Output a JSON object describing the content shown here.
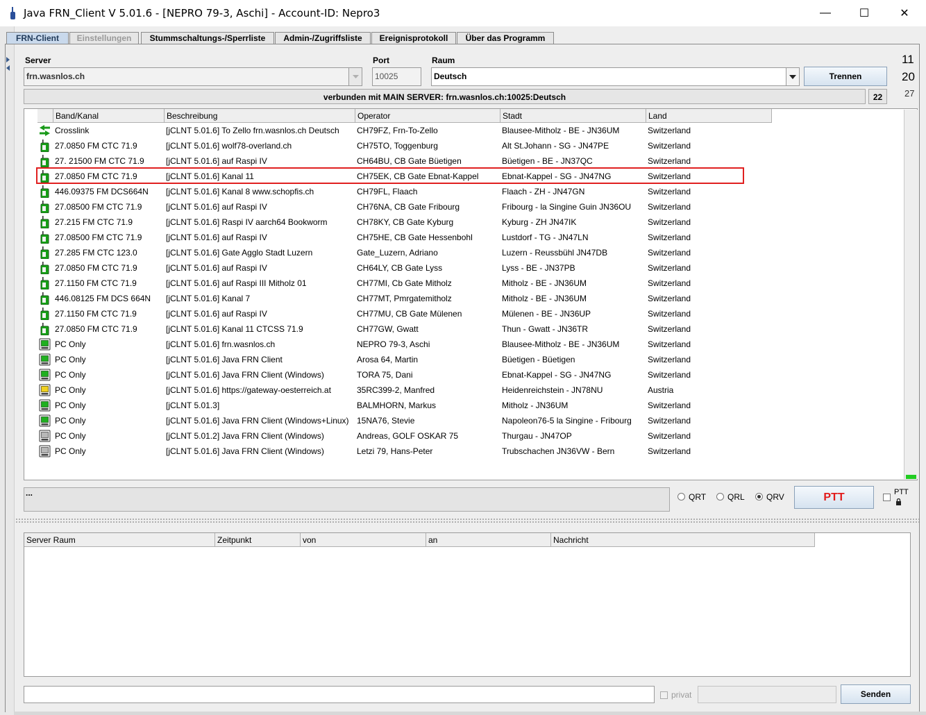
{
  "window": {
    "title": "Java FRN_Client V 5.01.6 - [NEPRO 79-3, Aschi] - Account-ID: Nepro3",
    "minimize": "—",
    "maximize": "☐",
    "close": "✕"
  },
  "tabs": [
    {
      "label": "FRN-Client"
    },
    {
      "label": "Einstellungen"
    },
    {
      "label": "Stummschaltungs-/Sperrliste"
    },
    {
      "label": "Admin-/Zugriffsliste"
    },
    {
      "label": "Ereignisprotokoll"
    },
    {
      "label": "Über das Programm"
    }
  ],
  "connection": {
    "server_label": "Server",
    "server_value": "frn.wasnlos.ch",
    "port_label": "Port",
    "port_value": "10025",
    "room_label": "Raum",
    "room_value": "Deutsch",
    "disconnect_label": "Trennen",
    "status_text": "verbunden mit  MAIN SERVER: frn.wasnlos.ch:10025:Deutsch",
    "count": "22",
    "side_numbers": [
      "11",
      "20",
      "27"
    ]
  },
  "table": {
    "columns": [
      "Band/Kanal",
      "Beschreibung",
      "Operator",
      "Stadt",
      "Land"
    ],
    "rows": [
      {
        "icon": "crosslink",
        "band": "Crosslink",
        "desc": "[jCLNT 5.01.6] To Zello frn.wasnlos.ch Deutsch",
        "op": "CH79FZ, Frn-To-Zello",
        "city": "Blausee-Mitholz - BE - JN36UM",
        "country": "Switzerland"
      },
      {
        "icon": "radio-green",
        "band": "27.0850 FM CTC 71.9",
        "desc": "[jCLNT 5.01.6] wolf78-overland.ch",
        "op": "CH75TO, Toggenburg",
        "city": "Alt St.Johann - SG - JN47PE",
        "country": "Switzerland"
      },
      {
        "icon": "radio-green",
        "band": "27. 21500 FM CTC 71.9",
        "desc": "[jCLNT 5.01.6] auf Raspi IV",
        "op": "CH64BU, CB Gate Büetigen",
        "city": "Büetigen - BE - JN37QC",
        "country": "Switzerland"
      },
      {
        "icon": "radio-green",
        "band": "27.0850 FM CTC 71.9",
        "desc": "[jCLNT 5.01.6] Kanal 11",
        "op": "CH75EK, CB Gate Ebnat-Kappel",
        "city": "Ebnat-Kappel - SG - JN47NG",
        "country": "Switzerland"
      },
      {
        "icon": "radio-green",
        "band": "446.09375 FM DCS664N",
        "desc": "[jCLNT 5.01.6] Kanal 8  www.schopfis.ch",
        "op": "CH79FL, Flaach",
        "city": "Flaach - ZH - JN47GN",
        "country": "Switzerland"
      },
      {
        "icon": "radio-green",
        "band": "27.08500 FM CTC 71.9",
        "desc": "[jCLNT 5.01.6] auf Raspi IV",
        "op": "CH76NA, CB Gate Fribourg",
        "city": "Fribourg - la Singine Guin JN36OU",
        "country": "Switzerland"
      },
      {
        "icon": "radio-green",
        "band": "27.215 FM CTC 71.9",
        "desc": "[jCLNT 5.01.6] Raspi IV aarch64 Bookworm",
        "op": "CH78KY, CB Gate Kyburg",
        "city": "Kyburg - ZH JN47IK",
        "country": "Switzerland"
      },
      {
        "icon": "radio-green",
        "band": "27.08500 FM CTC 71.9",
        "desc": "[jCLNT 5.01.6] auf Raspi IV",
        "op": "CH75HE, CB Gate Hessenbohl",
        "city": "Lustdorf - TG - JN47LN",
        "country": "Switzerland"
      },
      {
        "icon": "radio-green",
        "band": "27.285 FM CTC 123.0",
        "desc": "[jCLNT 5.01.6] Gate Agglo Stadt Luzern",
        "op": "Gate_Luzern, Adriano",
        "city": "Luzern - Reussbühl JN47DB",
        "country": "Switzerland"
      },
      {
        "icon": "radio-green",
        "band": "27.0850 FM CTC 71.9",
        "desc": "[jCLNT 5.01.6] auf Raspi IV",
        "op": "CH64LY, CB Gate Lyss",
        "city": "Lyss - BE - JN37PB",
        "country": "Switzerland"
      },
      {
        "icon": "radio-green",
        "band": "27.1150 FM CTC 71.9",
        "desc": "[jCLNT 5.01.6] auf Raspi III  Mitholz 01",
        "op": "CH77MI, Cb Gate Mitholz",
        "city": "Mitholz - BE - JN36UM",
        "country": "Switzerland"
      },
      {
        "icon": "radio-green",
        "band": "446.08125 FM DCS 664N",
        "desc": "[jCLNT 5.01.6] Kanal 7",
        "op": "CH77MT, Pmrgatemitholz",
        "city": "Mitholz - BE - JN36UM",
        "country": "Switzerland"
      },
      {
        "icon": "radio-green",
        "band": "27.1150 FM CTC 71.9",
        "desc": "[jCLNT 5.01.6] auf Raspi IV",
        "op": "CH77MU, CB Gate Mülenen",
        "city": "Mülenen - BE - JN36UP",
        "country": "Switzerland"
      },
      {
        "icon": "radio-green",
        "band": "27.0850 FM CTC 71.9",
        "desc": "[jCLNT 5.01.6] Kanal 11 CTCSS 71.9",
        "op": "CH77GW, Gwatt",
        "city": "Thun - Gwatt - JN36TR",
        "country": "Switzerland"
      },
      {
        "icon": "pc-green",
        "band": "PC Only",
        "desc": "[jCLNT 5.01.6] frn.wasnlos.ch",
        "op": "NEPRO 79-3, Aschi",
        "city": "Blausee-Mitholz - BE - JN36UM",
        "country": "Switzerland"
      },
      {
        "icon": "pc-green",
        "band": "PC Only",
        "desc": "[jCLNT 5.01.6] Java FRN Client",
        "op": "Arosa 64, Martin",
        "city": "Büetigen - Büetigen",
        "country": "Switzerland"
      },
      {
        "icon": "pc-green",
        "band": "PC Only",
        "desc": "[jCLNT 5.01.6] Java FRN Client (Windows)",
        "op": "TORA 75, Dani",
        "city": "Ebnat-Kappel - SG - JN47NG",
        "country": "Switzerland"
      },
      {
        "icon": "pc-yellow",
        "band": "PC Only",
        "desc": "[jCLNT 5.01.6] https://gateway-oesterreich.at",
        "op": "35RC399-2, Manfred",
        "city": "Heidenreichstein - JN78NU",
        "country": "Austria"
      },
      {
        "icon": "pc-green",
        "band": "PC Only",
        "desc": "[jCLNT 5.01.3]",
        "op": "BALMHORN, Markus",
        "city": "Mitholz - JN36UM",
        "country": "Switzerland"
      },
      {
        "icon": "pc-green",
        "band": "PC Only",
        "desc": "[jCLNT 5.01.6] Java FRN Client (Windows+Linux)",
        "op": "15NA76, Stevie",
        "city": "Napoleon76-5 la Singine - Fribourg",
        "country": "Switzerland"
      },
      {
        "icon": "pc-gray",
        "band": "PC Only",
        "desc": "[jCLNT 5.01.2] Java FRN Client (Windows)",
        "op": "Andreas, GOLF OSKAR 75",
        "city": "Thurgau - JN47OP",
        "country": "Switzerland"
      },
      {
        "icon": "pc-gray",
        "band": "PC Only",
        "desc": "[jCLNT 5.01.6] Java FRN Client (Windows)",
        "op": "Letzi 79, Hans-Peter",
        "city": "Trubschachen JN36VW - Bern",
        "country": "Switzerland"
      }
    ]
  },
  "status": {
    "message": "...",
    "qrt": "QRT",
    "qrl": "QRL",
    "qrv": "QRV",
    "ptt": "PTT",
    "ptt_lock_label": "PTT"
  },
  "messages": {
    "columns": [
      "Server Raum",
      "Zeitpunkt",
      "von",
      "an",
      "Nachricht"
    ]
  },
  "compose": {
    "private_label": "privat",
    "send_label": "Senden"
  },
  "colors": {
    "tab_active": "#c9d9ec",
    "highlight": "#e02020",
    "ptt_text": "#e21b1b",
    "level_meter": "#22cc22"
  }
}
